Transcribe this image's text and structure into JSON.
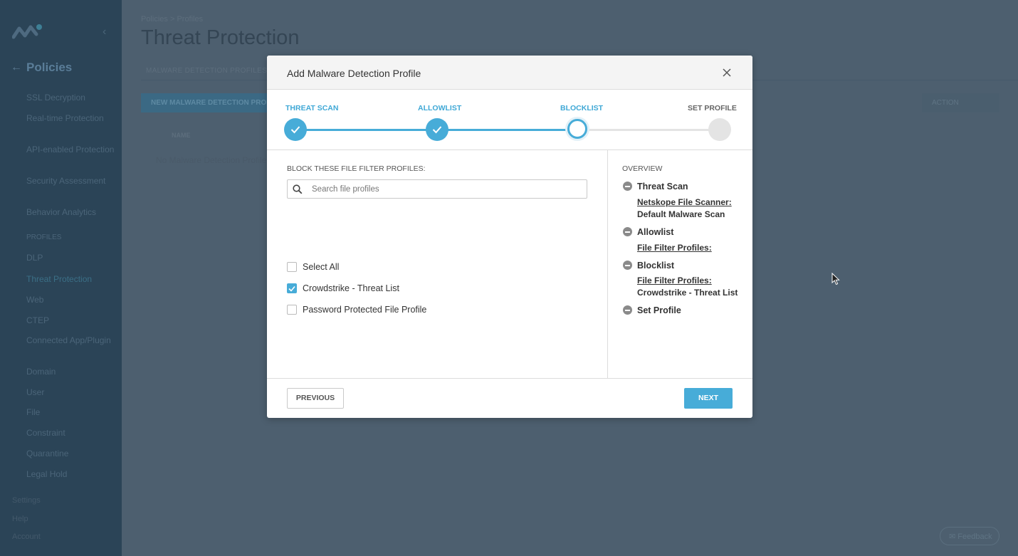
{
  "sidebar": {
    "title": "Policies",
    "items": [
      "SSL Decryption",
      "Real-time Protection",
      "API-enabled Protection",
      "Security Assessment",
      "Behavior Analytics",
      "PROFILES",
      "DLP",
      "Threat Protection",
      "Web",
      "CTEP",
      "Connected App/Plugin",
      "Domain",
      "User",
      "File",
      "Constraint",
      "Quarantine",
      "Legal Hold"
    ],
    "bottom": [
      "Settings",
      "Help",
      "Account"
    ]
  },
  "page": {
    "breadcrumb": "Policies > Profiles",
    "title": "Threat Protection",
    "tab": "MALWARE DETECTION PROFILES",
    "new_button": "NEW MALWARE DETECTION PROFILE",
    "right_button": "ACTION",
    "column_name": "NAME",
    "empty_text": "No Malware Detection Profiles",
    "feedback": "Feedback"
  },
  "modal": {
    "title": "Add Malware Detection Profile",
    "steps": [
      {
        "label": "THREAT SCAN",
        "state": "done"
      },
      {
        "label": "ALLOWLIST",
        "state": "done"
      },
      {
        "label": "BLOCKLIST",
        "state": "current"
      },
      {
        "label": "SET PROFILE",
        "state": "todo"
      }
    ],
    "section_label": "BLOCK THESE FILE FILTER PROFILES:",
    "search_placeholder": "Search file profiles",
    "options": [
      {
        "label": "Select All",
        "checked": false
      },
      {
        "label": "Crowdstrike - Threat List",
        "checked": true
      },
      {
        "label": "Password Protected File Profile",
        "checked": false
      }
    ],
    "overview": {
      "title": "OVERVIEW",
      "items": [
        {
          "heading": "Threat Scan",
          "link": "Netskope File Scanner:",
          "value": "Default Malware Scan"
        },
        {
          "heading": "Allowlist",
          "link": "File Filter Profiles:",
          "value": ""
        },
        {
          "heading": "Blocklist",
          "link": "File Filter Profiles:",
          "value": "Crowdstrike - Threat List"
        },
        {
          "heading": "Set Profile",
          "link": "",
          "value": ""
        }
      ]
    },
    "previous_label": "PREVIOUS",
    "next_label": "NEXT"
  },
  "colors": {
    "accent": "#47acd8",
    "overlay": "#4d5f6f",
    "sidebar": "#2b4457"
  },
  "icons": [
    "netskope-logo-icon",
    "collapse-icon",
    "back-arrow-icon",
    "close-icon",
    "check-icon",
    "search-icon",
    "minus-circle-icon",
    "mail-icon",
    "mouse-cursor-icon"
  ]
}
